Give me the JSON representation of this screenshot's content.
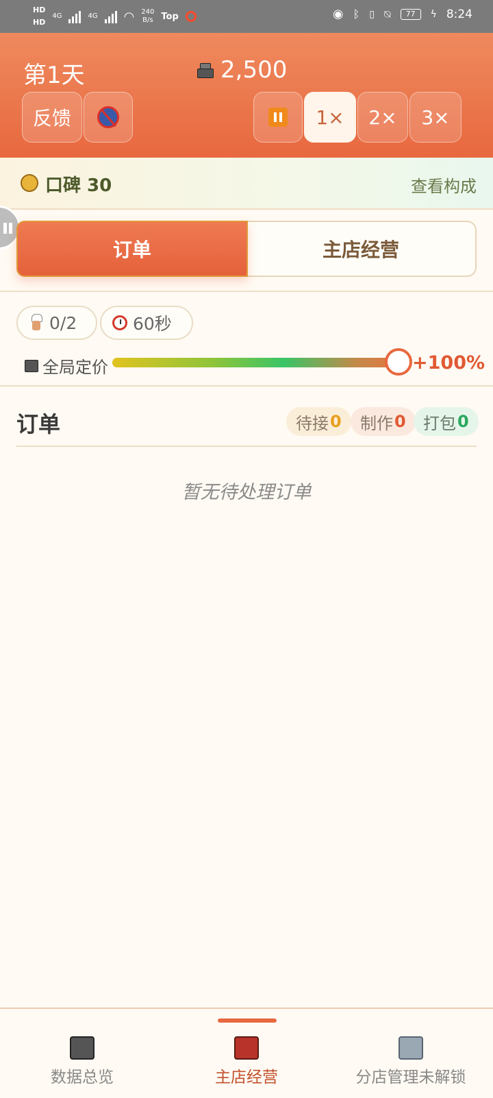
{
  "status_bar": {
    "hd1": "HD",
    "hd2": "HD",
    "net1": "4G",
    "net2": "4G",
    "speed_value": "240",
    "speed_unit": "B/s",
    "top_label": "Top",
    "battery": "77",
    "time": "8:24"
  },
  "header": {
    "day": "第1天",
    "money": "2,500",
    "feedback_label": "反馈",
    "speeds": [
      "1×",
      "2×",
      "3×"
    ],
    "active_speed": "1×"
  },
  "reputation": {
    "label": "口碑 30",
    "link": "查看构成"
  },
  "tabs": [
    "订单",
    "主店经营"
  ],
  "controls": {
    "staff": "0/2",
    "timer": "60秒",
    "price_label": "全局定价",
    "price_value": "+100%",
    "price_slider_fraction": 1.0
  },
  "orders": {
    "title": "订单",
    "pending_label": "待接",
    "pending_count": "0",
    "making_label": "制作",
    "making_count": "0",
    "packing_label": "打包",
    "packing_count": "0",
    "empty_message": "暂无待处理订单"
  },
  "bottom_nav": [
    {
      "label": "数据总览",
      "icon": "cash-register-icon"
    },
    {
      "label": "主店经营",
      "icon": "shop-icon"
    },
    {
      "label": "分店管理未解锁",
      "icon": "branch-building-icon"
    }
  ],
  "colors": {
    "accent": "#e8683f",
    "header_top": "#ef8a5e",
    "background": "#fffaf3"
  }
}
